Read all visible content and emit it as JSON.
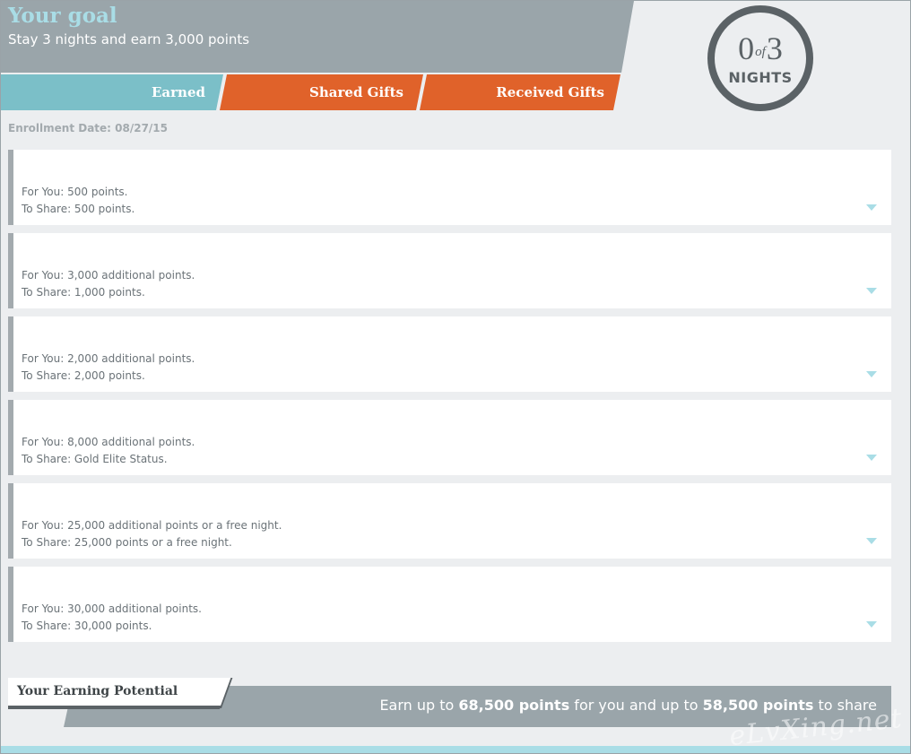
{
  "goal": {
    "title": "Your goal",
    "subtitle": "Stay 3 nights and earn 3,000 points"
  },
  "tabs": [
    {
      "label": "Earned"
    },
    {
      "label": "Shared Gifts"
    },
    {
      "label": "Received Gifts"
    }
  ],
  "nights": {
    "current": "0",
    "of_word": "of",
    "goal": "3",
    "label": "NIGHTS"
  },
  "enrollment": "Enrollment Date: 08/27/15",
  "tiers": [
    {
      "for_you": "For You: 500 points.",
      "to_share": "To Share: 500 points."
    },
    {
      "for_you": "For You: 3,000 additional points.",
      "to_share": "To Share: 1,000 points."
    },
    {
      "for_you": "For You: 2,000 additional points.",
      "to_share": "To Share: 2,000 points."
    },
    {
      "for_you": "For You: 8,000 additional points.",
      "to_share": "To Share: Gold Elite Status."
    },
    {
      "for_you": "For You: 25,000 additional points or a free night.",
      "to_share": "To Share: 25,000 points or a free night."
    },
    {
      "for_you": "For You: 30,000 additional points.",
      "to_share": "To Share: 30,000 points."
    }
  ],
  "potential": {
    "heading": "Your Earning Potential",
    "pre": "Earn up to ",
    "you_points": "68,500 points",
    "mid": " for you and up to ",
    "share_points": "58,500 points",
    "post": " to share"
  },
  "watermark": "eLvXing.net",
  "colors": {
    "teal": "#7bbfc8",
    "orange": "#e0622a",
    "slate": "#9aa5aa",
    "ring": "#5b6266"
  }
}
